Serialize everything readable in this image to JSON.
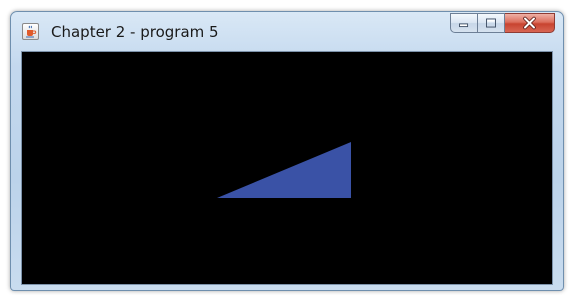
{
  "window": {
    "title": "Chapter 2 - program 5",
    "icon": "java-coffee-cup-icon",
    "controls": [
      "minimize-icon",
      "maximize-icon",
      "close-icon"
    ]
  },
  "canvas": {
    "background": "#000000",
    "shape": {
      "type": "right-triangle",
      "fill": "#3a52a6"
    }
  },
  "colors": {
    "frame": "#bcd3ea",
    "close_button": "#c84430"
  }
}
